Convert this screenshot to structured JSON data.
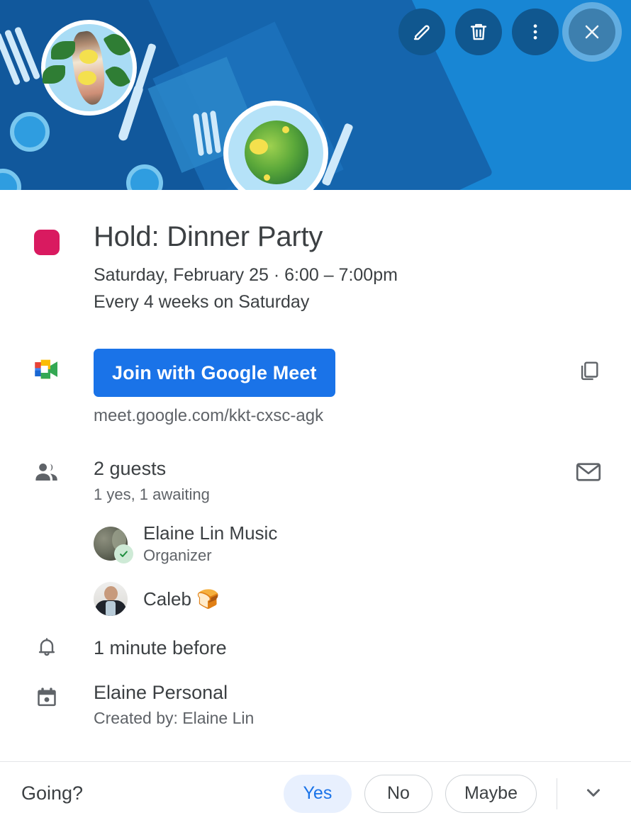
{
  "header": {
    "background_color": "#1886d4",
    "actions": [
      {
        "name": "edit",
        "label": "Edit event",
        "icon": "pencil-icon"
      },
      {
        "name": "delete",
        "label": "Delete event",
        "icon": "trash-icon"
      },
      {
        "name": "more",
        "label": "More options",
        "icon": "more-vert-icon"
      },
      {
        "name": "close",
        "label": "Close",
        "icon": "close-icon",
        "focused": true
      }
    ]
  },
  "event": {
    "color": "#d91a60",
    "title": "Hold: Dinner Party",
    "when": "Saturday, February 25  ·  6:00 – 7:00pm",
    "recurrence": "Every 4 weeks on Saturday"
  },
  "conference": {
    "provider_icon": "google-meet-icon",
    "join_label": "Join with Google Meet",
    "link": "meet.google.com/kkt-cxsc-agk",
    "copy_icon": "copy-icon",
    "button_color": "#1a73e8"
  },
  "guests": {
    "icon": "people-icon",
    "count_label": "2 guests",
    "status_label": "1 yes, 1 awaiting",
    "email_icon": "envelope-icon",
    "list": [
      {
        "name": "Elaine Lin Music",
        "role": "Organizer",
        "rsvp": "yes",
        "avatar": "elaine-avatar"
      },
      {
        "name": "Caleb 🍞",
        "role": "",
        "rsvp": "awaiting",
        "avatar": "caleb-avatar"
      }
    ]
  },
  "notification": {
    "icon": "bell-icon",
    "text": "1 minute before"
  },
  "calendar": {
    "icon": "calendar-icon",
    "name": "Elaine Personal",
    "created_by": "Created by: Elaine Lin"
  },
  "rsvp": {
    "prompt": "Going?",
    "options": [
      {
        "label": "Yes",
        "selected": true
      },
      {
        "label": "No",
        "selected": false
      },
      {
        "label": "Maybe",
        "selected": false
      }
    ],
    "more_icon": "chevron-down-icon",
    "selected_color": "#1a73e8",
    "selected_bg": "#e8f0fe"
  }
}
